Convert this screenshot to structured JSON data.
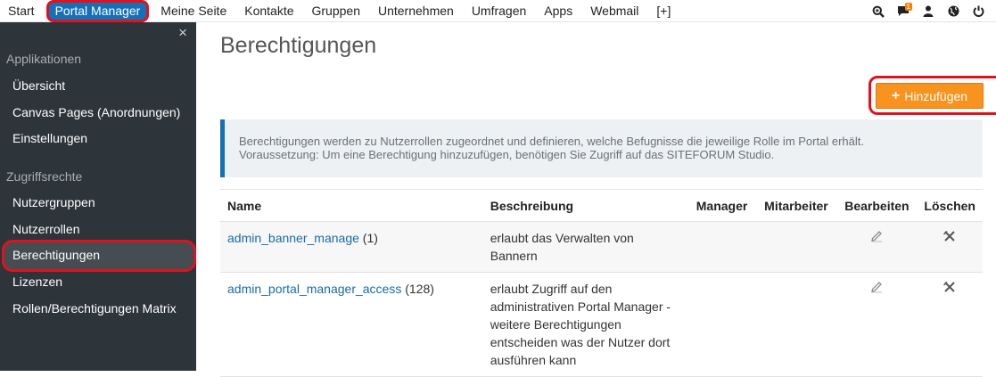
{
  "nav": {
    "items": [
      "Start",
      "Portal Manager",
      "Meine Seite",
      "Kontakte",
      "Gruppen",
      "Unternehmen",
      "Umfragen",
      "Apps",
      "Webmail",
      "[+]"
    ],
    "active_index": 1,
    "notification_count": "1",
    "icons": [
      "search-icon",
      "chat-icon",
      "user-icon",
      "globe-icon",
      "power-icon"
    ]
  },
  "sidebar": {
    "close": "×",
    "section1": "Applikationen",
    "items1": [
      "Übersicht",
      "Canvas Pages (Anordnungen)",
      "Einstellungen"
    ],
    "section2": "Zugriffsrechte",
    "items2": [
      "Nutzergruppen",
      "Nutzerrollen",
      "Berechtigungen",
      "Lizenzen",
      "Rollen/Berechtigungen Matrix"
    ],
    "active": "Berechtigungen"
  },
  "main": {
    "title": "Berechtigungen",
    "add_label": "Hinzufügen",
    "info_line1": "Berechtigungen werden zu Nutzerrollen zugeordnet und definieren, welche Befugnisse die jeweilige Rolle im Portal erhält.",
    "info_line2": "Voraussetzung: Um eine Berechtigung hinzuzufügen, benötigen Sie Zugriff auf das SITEFORUM Studio."
  },
  "table": {
    "headers": {
      "name": "Name",
      "description": "Beschreibung",
      "manager": "Manager",
      "mitarbeiter": "Mitarbeiter",
      "edit": "Bearbeiten",
      "delete": "Löschen"
    },
    "rows": [
      {
        "name": "admin_banner_manage",
        "count": " (1)",
        "description": [
          "erlaubt das Verwalten von",
          "Bannern"
        ]
      },
      {
        "name": "admin_portal_manager_access",
        "count": " (128)",
        "description": [
          "erlaubt Zugriff auf den",
          "administrativen Portal Manager -",
          "weitere Berechtigungen",
          "entscheiden was der Nutzer dort",
          "ausführen kann"
        ]
      }
    ]
  },
  "colors": {
    "nav_active": "#1570b8",
    "highlight": "#e0121d",
    "add_button": "#f7931e",
    "sidebar_bg": "#2d343a",
    "link": "#1a6aa8"
  }
}
